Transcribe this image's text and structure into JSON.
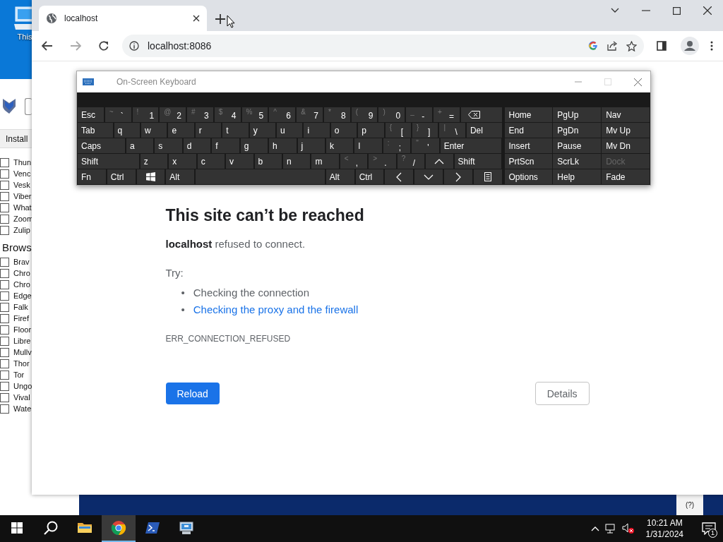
{
  "desktop": {
    "icon_label": "This"
  },
  "installer": {
    "button": "Install",
    "items": [
      {
        "label": "Thun",
        "checked": false
      },
      {
        "label": "Venc",
        "checked": false
      },
      {
        "label": "Vesk",
        "checked": false
      },
      {
        "label": "Viber",
        "checked": false
      },
      {
        "label": "What",
        "checked": false
      },
      {
        "label": "Zoom",
        "checked": false
      },
      {
        "label": "Zulip",
        "checked": false
      }
    ],
    "section": "Brows",
    "section_items": [
      {
        "label": "Brav",
        "checked": false
      },
      {
        "label": "Chro",
        "checked": false
      },
      {
        "label": "Chro",
        "checked": false
      },
      {
        "label": "Edge",
        "checked": false
      },
      {
        "label": "Falk",
        "checked": false
      },
      {
        "label": "Firef",
        "checked": false
      },
      {
        "label": "Floor",
        "checked": false
      },
      {
        "label": "Libre",
        "checked": false
      },
      {
        "label": "Mullv",
        "checked": false
      },
      {
        "label": "Thor",
        "checked": false
      },
      {
        "label": "Tor",
        "checked": false
      },
      {
        "label": "Ungo",
        "checked": false
      },
      {
        "label": "Vival",
        "checked": false
      },
      {
        "label": "Wate",
        "checked": false
      }
    ]
  },
  "background": {
    "help": "(?)"
  },
  "browser": {
    "tabs": [
      {
        "title": "localhost",
        "selected": true
      }
    ],
    "address": "localhost:8086",
    "error": {
      "title": "This site can’t be reached",
      "message": "**localhost** refused to connect.",
      "try_label": "Try:",
      "suggestions": [
        {
          "bullet": "•",
          "text": "Checking the connection",
          "kind": "text"
        },
        {
          "bullet": "•",
          "text": "Checking the proxy and the firewall",
          "kind": "link"
        }
      ],
      "code": "ERR_CONNECTION_REFUSED",
      "reload": "Reload",
      "details": "Details"
    }
  },
  "keyboard": {
    "title": "On-Screen Keyboard",
    "rows": [
      {
        "keys": [
          {
            "label": "Esc",
            "kind": "key"
          },
          {
            "label": "`",
            "shift": "~",
            "kind": "key"
          },
          {
            "label": "1",
            "shift": "!",
            "kind": "key"
          },
          {
            "label": "2",
            "shift": "@",
            "kind": "key"
          },
          {
            "label": "3",
            "shift": "#",
            "kind": "key"
          },
          {
            "label": "4",
            "shift": "$",
            "kind": "key"
          },
          {
            "label": "5",
            "shift": "%",
            "kind": "key"
          },
          {
            "label": "6",
            "shift": "^",
            "kind": "key"
          },
          {
            "label": "7",
            "shift": "&",
            "kind": "key"
          },
          {
            "label": "8",
            "shift": "*",
            "kind": "key"
          },
          {
            "label": "9",
            "shift": "(",
            "kind": "key"
          },
          {
            "label": "0",
            "shift": ")",
            "kind": "key"
          },
          {
            "label": "-",
            "shift": "_",
            "kind": "key"
          },
          {
            "label": "=",
            "shift": "+",
            "kind": "key"
          },
          {
            "kind": "backspace"
          }
        ]
      },
      {
        "keys": [
          {
            "label": "Tab",
            "kind": "wide"
          },
          {
            "label": "q",
            "kind": "key"
          },
          {
            "label": "w",
            "kind": "key"
          },
          {
            "label": "e",
            "kind": "key"
          },
          {
            "label": "r",
            "kind": "key"
          },
          {
            "label": "t",
            "kind": "key"
          },
          {
            "label": "y",
            "kind": "key"
          },
          {
            "label": "u",
            "kind": "key"
          },
          {
            "label": "i",
            "kind": "key"
          },
          {
            "label": "o",
            "kind": "key"
          },
          {
            "label": "p",
            "kind": "key"
          },
          {
            "label": "[",
            "shift": "{",
            "kind": "key"
          },
          {
            "label": "]",
            "shift": "}",
            "kind": "key"
          },
          {
            "label": "\\",
            "shift": "|",
            "kind": "key"
          },
          {
            "label": "Del",
            "kind": "wide"
          }
        ]
      },
      {
        "keys": [
          {
            "label": "Caps",
            "kind": "wider"
          },
          {
            "label": "a",
            "kind": "key"
          },
          {
            "label": "s",
            "kind": "key"
          },
          {
            "label": "d",
            "kind": "key"
          },
          {
            "label": "f",
            "kind": "key"
          },
          {
            "label": "g",
            "kind": "key"
          },
          {
            "label": "h",
            "kind": "key"
          },
          {
            "label": "j",
            "kind": "key"
          },
          {
            "label": "k",
            "kind": "key"
          },
          {
            "label": "l",
            "kind": "key"
          },
          {
            "label": ";",
            "shift": ":",
            "kind": "key"
          },
          {
            "label": "'",
            "shift": "\"",
            "kind": "key"
          },
          {
            "label": "Enter",
            "kind": "widest"
          }
        ]
      },
      {
        "keys": [
          {
            "label": "Shift",
            "kind": "widest"
          },
          {
            "label": "z",
            "kind": "key"
          },
          {
            "label": "x",
            "kind": "key"
          },
          {
            "label": "c",
            "kind": "key"
          },
          {
            "label": "v",
            "kind": "key"
          },
          {
            "label": "b",
            "kind": "key"
          },
          {
            "label": "n",
            "kind": "key"
          },
          {
            "label": "m",
            "kind": "key"
          },
          {
            "label": ",",
            "shift": "<",
            "kind": "key"
          },
          {
            "label": ".",
            "shift": ">",
            "kind": "key"
          },
          {
            "label": "/",
            "shift": "?",
            "kind": "key"
          },
          {
            "kind": "up"
          },
          {
            "label": "Shift",
            "kind": "wider"
          }
        ]
      },
      {
        "keys": [
          {
            "label": "Fn",
            "kind": "key"
          },
          {
            "label": "Ctrl",
            "kind": "key"
          },
          {
            "kind": "windows"
          },
          {
            "label": "Alt",
            "kind": "key"
          },
          {
            "kind": "space"
          },
          {
            "label": "Alt",
            "kind": "key"
          },
          {
            "label": "Ctrl",
            "kind": "key"
          },
          {
            "kind": "left"
          },
          {
            "kind": "down"
          },
          {
            "kind": "right"
          },
          {
            "kind": "menu"
          }
        ]
      }
    ],
    "nav_rows": [
      [
        {
          "label": "Home",
          "disabled": false
        },
        {
          "label": "PgUp",
          "disabled": false
        },
        {
          "label": "Nav",
          "disabled": false
        }
      ],
      [
        {
          "label": "End",
          "disabled": false
        },
        {
          "label": "PgDn",
          "disabled": false
        },
        {
          "label": "Mv Up",
          "disabled": false
        }
      ],
      [
        {
          "label": "Insert",
          "disabled": false
        },
        {
          "label": "Pause",
          "disabled": false
        },
        {
          "label": "Mv Dn",
          "disabled": false
        }
      ],
      [
        {
          "label": "PrtScn",
          "disabled": false
        },
        {
          "label": "ScrLk",
          "disabled": false
        },
        {
          "label": "Dock",
          "disabled": true
        }
      ],
      [
        {
          "label": "Options",
          "disabled": false
        },
        {
          "label": "Help",
          "disabled": false
        },
        {
          "label": "Fade",
          "disabled": false
        }
      ]
    ]
  },
  "taskbar": {
    "apps": [
      {
        "kind": "folder",
        "selected": false
      },
      {
        "kind": "chrome",
        "selected": true
      },
      {
        "kind": "terminal",
        "selected": false
      },
      {
        "kind": "computer",
        "selected": false
      }
    ],
    "time": "10:21 AM",
    "date": "1/31/2024",
    "notifications": "1"
  }
}
